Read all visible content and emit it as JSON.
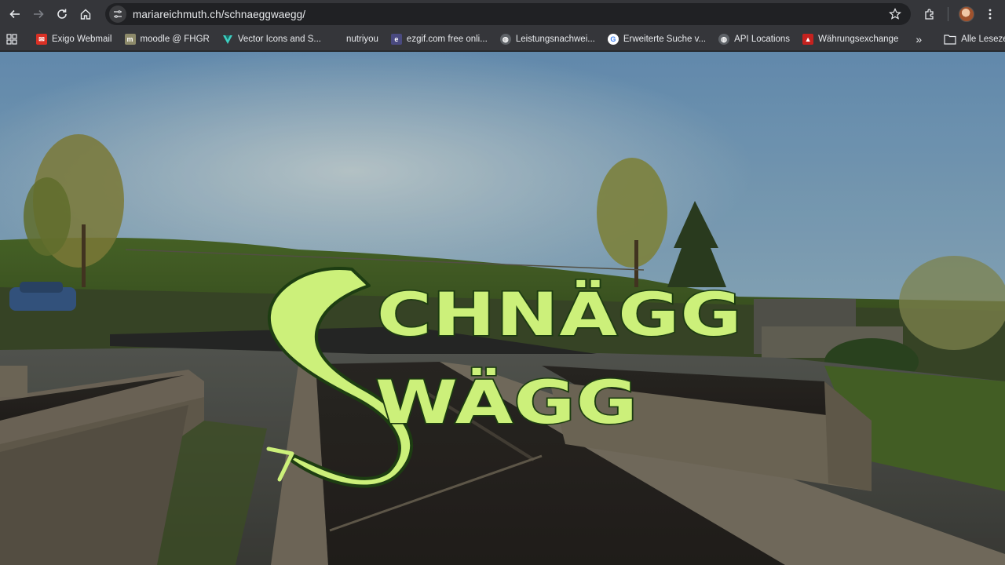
{
  "browser": {
    "url": "mariareichmuth.ch/schnaeggwaegg/",
    "nav": {
      "back": "back-icon",
      "forward": "forward-icon",
      "reload": "reload-icon",
      "home": "home-icon"
    }
  },
  "bookmarks": [
    {
      "label": "Exigo Webmail",
      "icon": "mail-icon",
      "color": "#d93025"
    },
    {
      "label": "moodle @ FHGR",
      "icon": "moodle-icon",
      "color": "#8d8a6a"
    },
    {
      "label": "Vector Icons and S...",
      "icon": "vector-icon",
      "color": "#3ccfc1"
    },
    {
      "label": "nutriyou",
      "icon": "none",
      "color": "#35363a"
    },
    {
      "label": "ezgif.com free onli...",
      "icon": "ezgif-icon",
      "color": "#6f6fd8"
    },
    {
      "label": "Leistungsnachwei...",
      "icon": "globe-icon",
      "color": "#9aa0a6"
    },
    {
      "label": "Erweiterte Suche v...",
      "icon": "google-icon",
      "color": "#4285f4"
    },
    {
      "label": "API Locations",
      "icon": "globe-icon",
      "color": "#9aa0a6"
    },
    {
      "label": "Währungsexchange",
      "icon": "exchange-icon",
      "color": "#c5221f"
    }
  ],
  "bookmarks_more": "»",
  "all_bookmarks": "Alle Lesezeichen",
  "hero": {
    "line1": "CHNÄGG",
    "line2": "WÄGG",
    "big_letter": "S",
    "logo_color": "#ccf07a",
    "outline_color": "#1d3d12"
  }
}
